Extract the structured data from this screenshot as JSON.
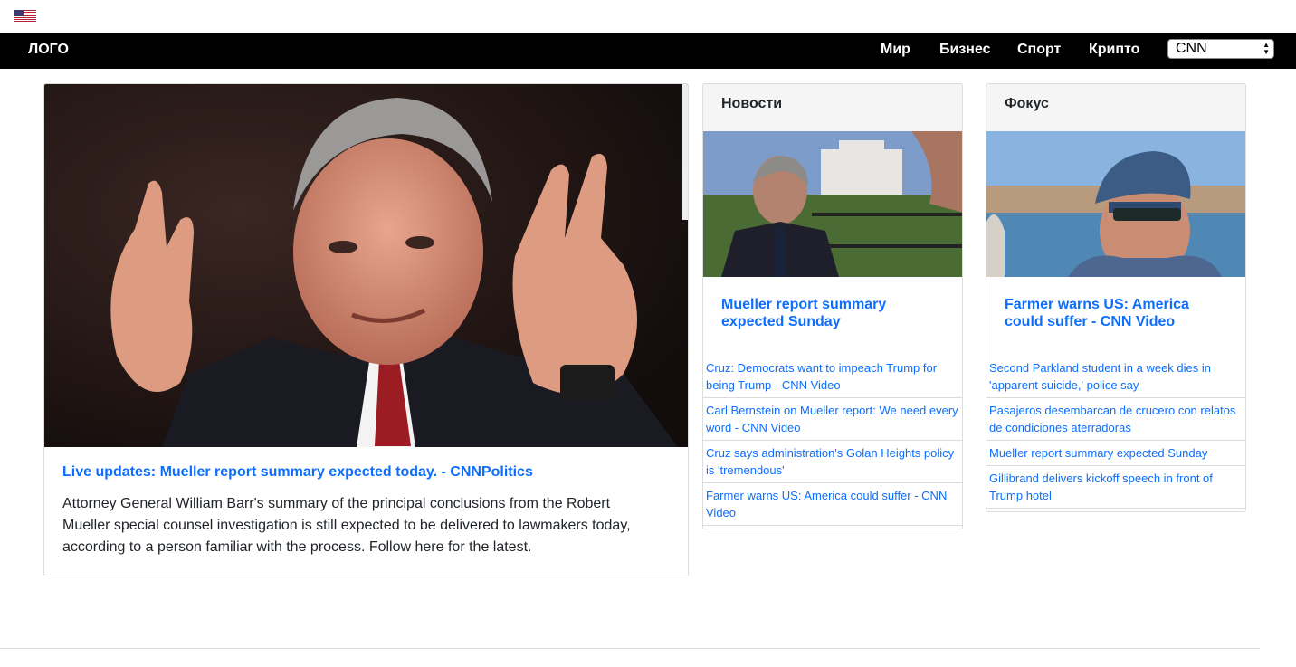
{
  "flag_icon": "us-flag-icon",
  "nav": {
    "logo": "ЛОГО",
    "links": [
      "Мир",
      "Бизнес",
      "Спорт",
      "Крипто"
    ],
    "source_select": "CNN"
  },
  "main": {
    "title": "Live updates: Mueller report summary expected today. - CNNPolitics",
    "description": "Attorney General William Barr's summary of the principal conclusions from the Robert Mueller special counsel investigation is still expected to be delivered to lawmakers today, according to a person familiar with the process. Follow here for the latest."
  },
  "news": {
    "header": "Новости",
    "title": "Mueller report summary expected Sunday",
    "items": [
      "Cruz: Democrats want to impeach Trump for being Trump - CNN Video",
      "Carl Bernstein on Mueller report: We need every word - CNN Video",
      "Cruz says administration's Golan Heights policy is 'tremendous'",
      "Farmer warns US: America could suffer - CNN Video"
    ]
  },
  "focus": {
    "header": "Фокус",
    "title": "Farmer warns US: America could suffer - CNN Video",
    "items": [
      "Second Parkland student in a week dies in 'apparent suicide,' police say",
      "Pasajeros desembarcan de crucero con relatos de condiciones aterradoras",
      "Mueller report summary expected Sunday",
      "Gillibrand delivers kickoff speech in front of Trump hotel"
    ]
  }
}
